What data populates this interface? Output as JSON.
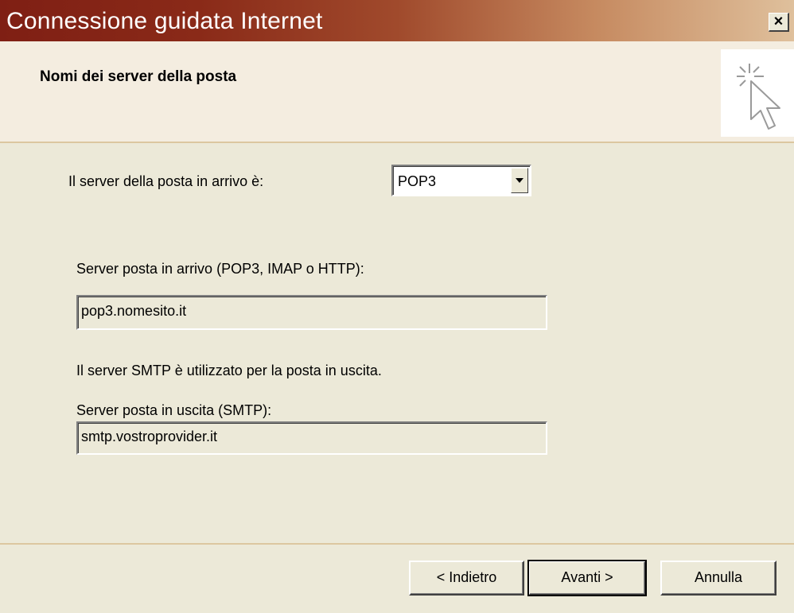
{
  "window": {
    "title": "Connessione guidata Internet",
    "close_label": "×"
  },
  "header": {
    "title": "Nomi dei server della posta",
    "icon": "wizard-cursor-icon"
  },
  "form": {
    "incoming_type_label": "Il server della posta in arrivo è:",
    "incoming_type_value": "POP3",
    "incoming_server_label": "Server posta in arrivo (POP3, IMAP o HTTP):",
    "incoming_server_value": "pop3.nomesito.it",
    "smtp_info": "Il server SMTP è utilizzato per la posta in uscita.",
    "outgoing_server_label": "Server posta in uscita (SMTP):",
    "outgoing_server_value": "smtp.vostroprovider.it"
  },
  "buttons": {
    "back": "< Indietro",
    "next": "Avanti >",
    "cancel": "Annulla"
  },
  "colors": {
    "titlebar_start": "#7f1f14",
    "titlebar_end": "#dfc09c",
    "dialog_bg": "#ece9d8",
    "header_bg": "#f4ede0"
  }
}
